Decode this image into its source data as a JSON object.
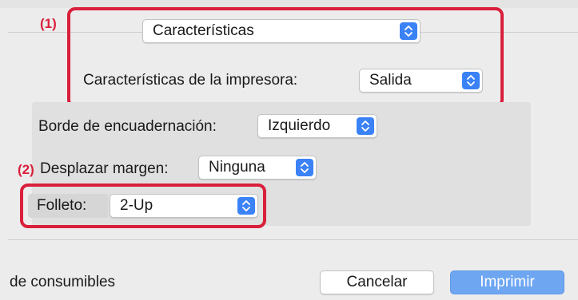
{
  "callouts": {
    "one": "(1)",
    "two": "(2)"
  },
  "feature_menu": {
    "value": "Características"
  },
  "printer_features": {
    "label": "Características de la impresora:",
    "value": "Salida"
  },
  "binding_edge": {
    "label": "Borde de encuadernación:",
    "value": "Izquierdo"
  },
  "margin_shift": {
    "label": "Desplazar margen:",
    "value": "Ninguna"
  },
  "booklet": {
    "label": "Folleto:",
    "value": "2-Up"
  },
  "footer": {
    "supplies_text": "de consumibles",
    "cancel_label": "Cancelar",
    "print_label": "Imprimir"
  },
  "colors": {
    "callout_red": "#d91f3b",
    "accent_blue": "#3b82f6",
    "print_button": "#6ea6f2"
  }
}
